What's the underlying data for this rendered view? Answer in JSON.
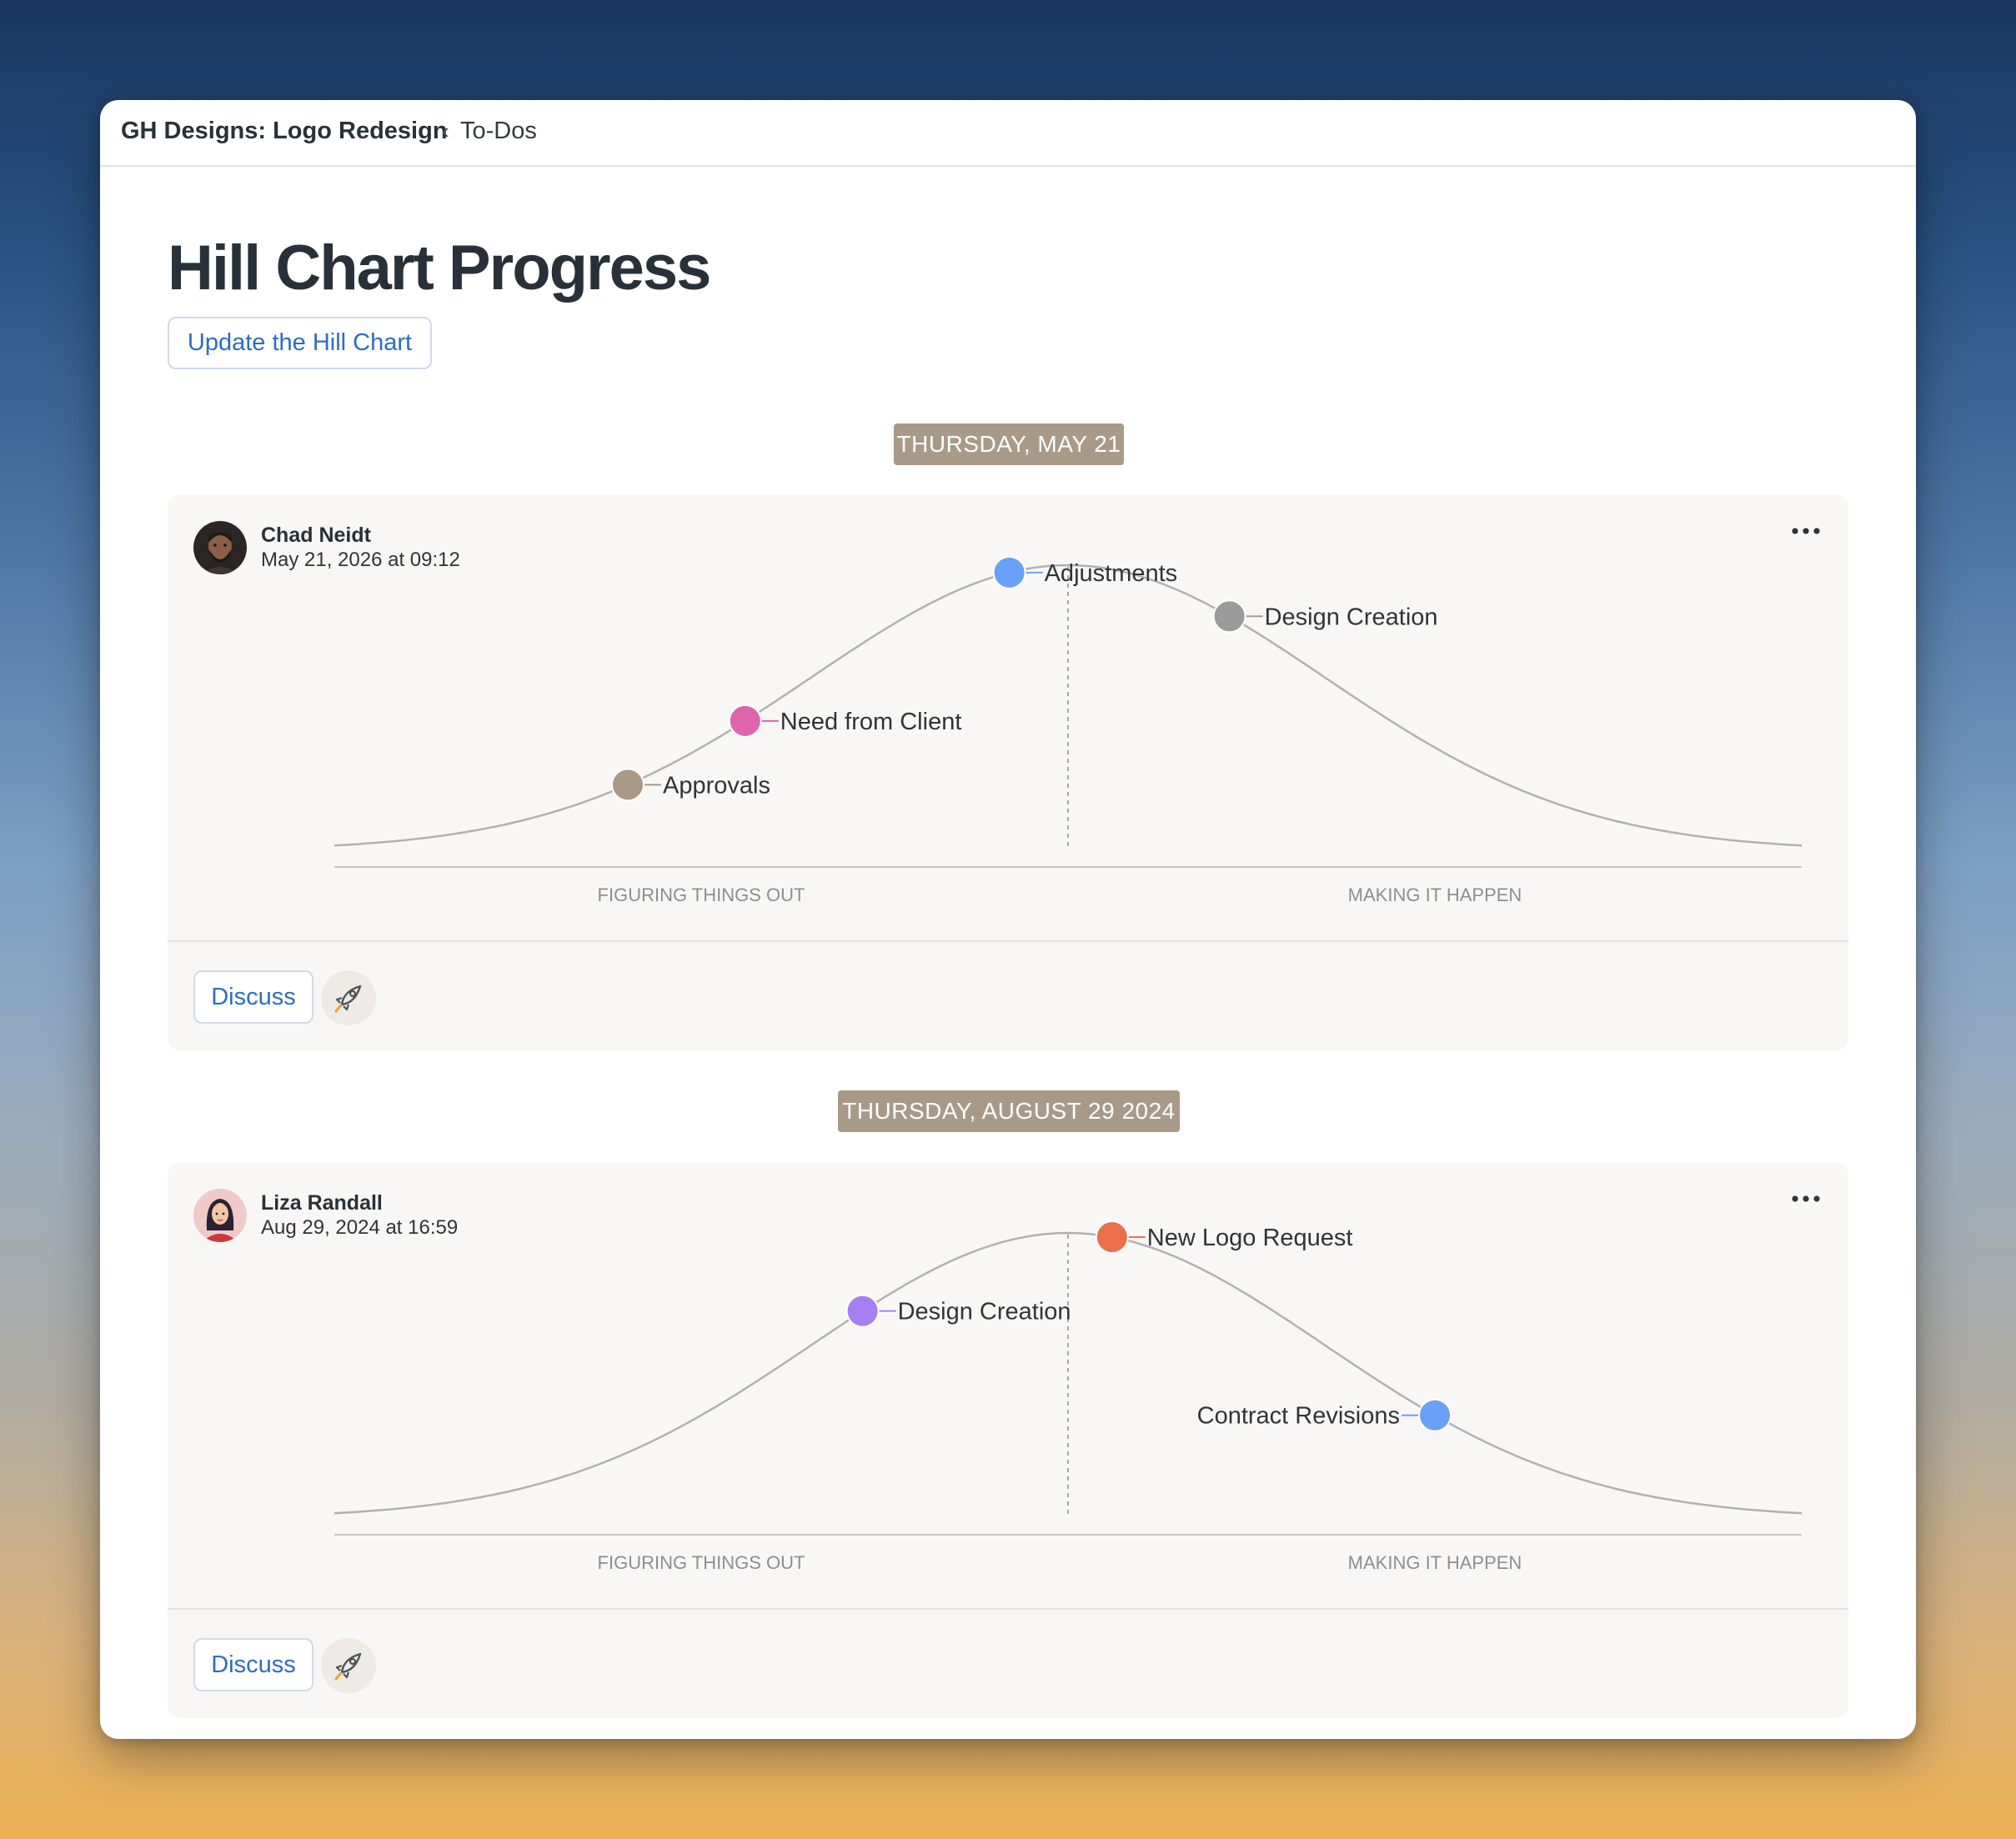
{
  "breadcrumb": {
    "project": "GH Designs: Logo Redesign",
    "separator": "‹",
    "current": "To-Dos"
  },
  "page": {
    "title": "Hill Chart Progress",
    "update_button": "Update the Hill Chart"
  },
  "colors": {
    "accent_blue": "#2f6bc4",
    "badge": "#a89a87",
    "title": "#283139"
  },
  "entries": [
    {
      "date_badge": "THURSDAY, MAY 21",
      "author": "Chad Neidt",
      "timestamp": "May 21, 2026 at 09:12",
      "avatar_icon": "man-beard-avatar",
      "left_label": "FIGURING THINGS OUT",
      "right_label": "MAKING IT HAPPEN",
      "discuss": "Discuss",
      "boost_icon": "rocket-icon",
      "more_icon": "ellipsis-icon",
      "chart_data": {
        "type": "scatter",
        "x_range": [
          0,
          100
        ],
        "points": [
          {
            "label": "Adjustments",
            "x": 46,
            "color": "#6aa0f6",
            "label_side": "right"
          },
          {
            "label": "Design Creation",
            "x": 61,
            "color": "#9b9b9b",
            "label_side": "right"
          },
          {
            "label": "Need from Client",
            "x": 28,
            "color": "#de64ad",
            "label_side": "right"
          },
          {
            "label": "Approvals",
            "x": 20,
            "color": "#ab9a86",
            "label_side": "right"
          }
        ]
      }
    },
    {
      "date_badge": "THURSDAY, AUGUST 29 2024",
      "author": "Liza Randall",
      "timestamp": "Aug 29, 2024 at 16:59",
      "avatar_icon": "woman-avatar",
      "left_label": "FIGURING THINGS OUT",
      "right_label": "MAKING IT HAPPEN",
      "discuss": "Discuss",
      "boost_icon": "rocket-icon",
      "more_icon": "ellipsis-icon",
      "chart_data": {
        "type": "scatter",
        "x_range": [
          0,
          100
        ],
        "points": [
          {
            "label": "New Logo Request",
            "x": 53,
            "color": "#eb7049",
            "label_side": "right"
          },
          {
            "label": "Design Creation",
            "x": 36,
            "color": "#a77ff3",
            "label_side": "right"
          },
          {
            "label": "Contract Revisions",
            "x": 75,
            "color": "#6aa0f6",
            "label_side": "left"
          }
        ]
      }
    }
  ]
}
